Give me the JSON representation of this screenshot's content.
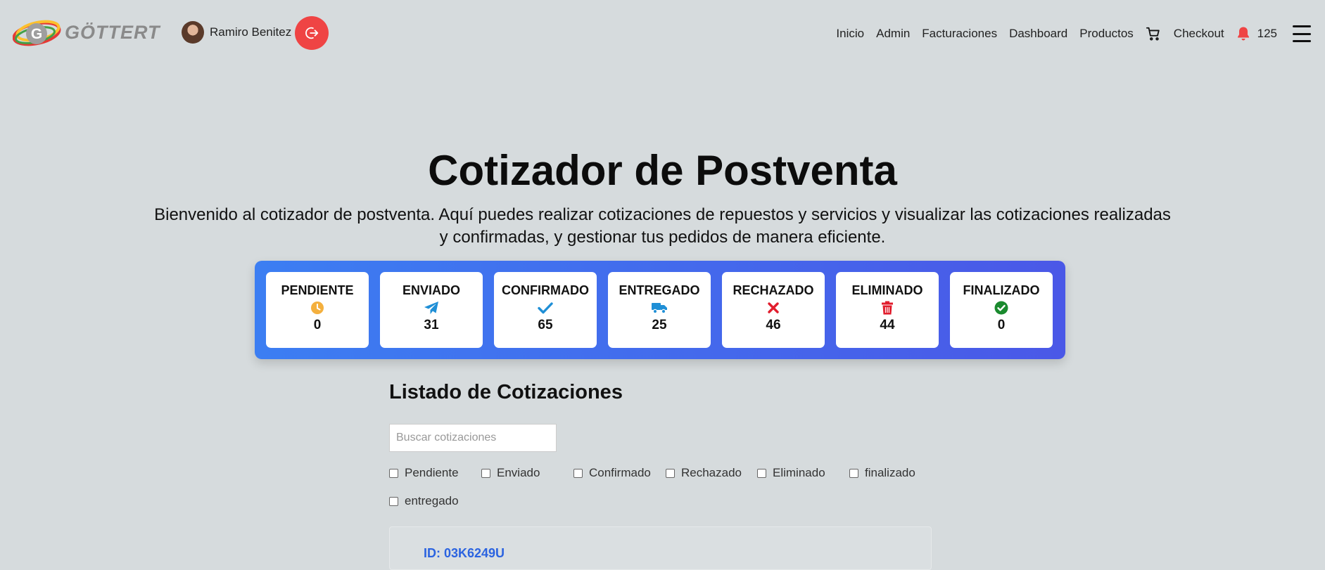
{
  "header": {
    "brand": "GÖTTERT",
    "user_name": "Ramiro Benitez",
    "nav": [
      "Inicio",
      "Admin",
      "Facturaciones",
      "Dashboard",
      "Productos"
    ],
    "checkout": "Checkout",
    "notification_count": "125"
  },
  "main": {
    "title": "Cotizador de Postventa",
    "subtitle": "Bienvenido al cotizador de postventa. Aquí puedes realizar cotizaciones de repuestos y servicios y visualizar las cotizaciones realizadas y confirmadas, y gestionar tus pedidos de manera eficiente."
  },
  "status_cards": [
    {
      "label": "PENDIENTE",
      "value": "0",
      "icon": "clock-icon",
      "color": "#f4b03e"
    },
    {
      "label": "ENVIADO",
      "value": "31",
      "icon": "paper-plane-icon",
      "color": "#1f8fd6"
    },
    {
      "label": "CONFIRMADO",
      "value": "65",
      "icon": "check-icon",
      "color": "#1f8fd6"
    },
    {
      "label": "ENTREGADO",
      "value": "25",
      "icon": "truck-icon",
      "color": "#1f8fd6"
    },
    {
      "label": "RECHAZADO",
      "value": "46",
      "icon": "x-icon",
      "color": "#e11d2d"
    },
    {
      "label": "ELIMINADO",
      "value": "44",
      "icon": "trash-icon",
      "color": "#e11d2d"
    },
    {
      "label": "FINALIZADO",
      "value": "0",
      "icon": "check-circle-icon",
      "color": "#1a8a2e"
    }
  ],
  "list": {
    "title": "Listado de Cotizaciones",
    "search_placeholder": "Buscar cotizaciones",
    "filters": [
      "Pendiente",
      "Enviado",
      "Confirmado",
      "Rechazado",
      "Eliminado",
      "finalizado",
      "entregado"
    ]
  },
  "quotes": [
    {
      "id": "ID: 03K6249U"
    }
  ]
}
